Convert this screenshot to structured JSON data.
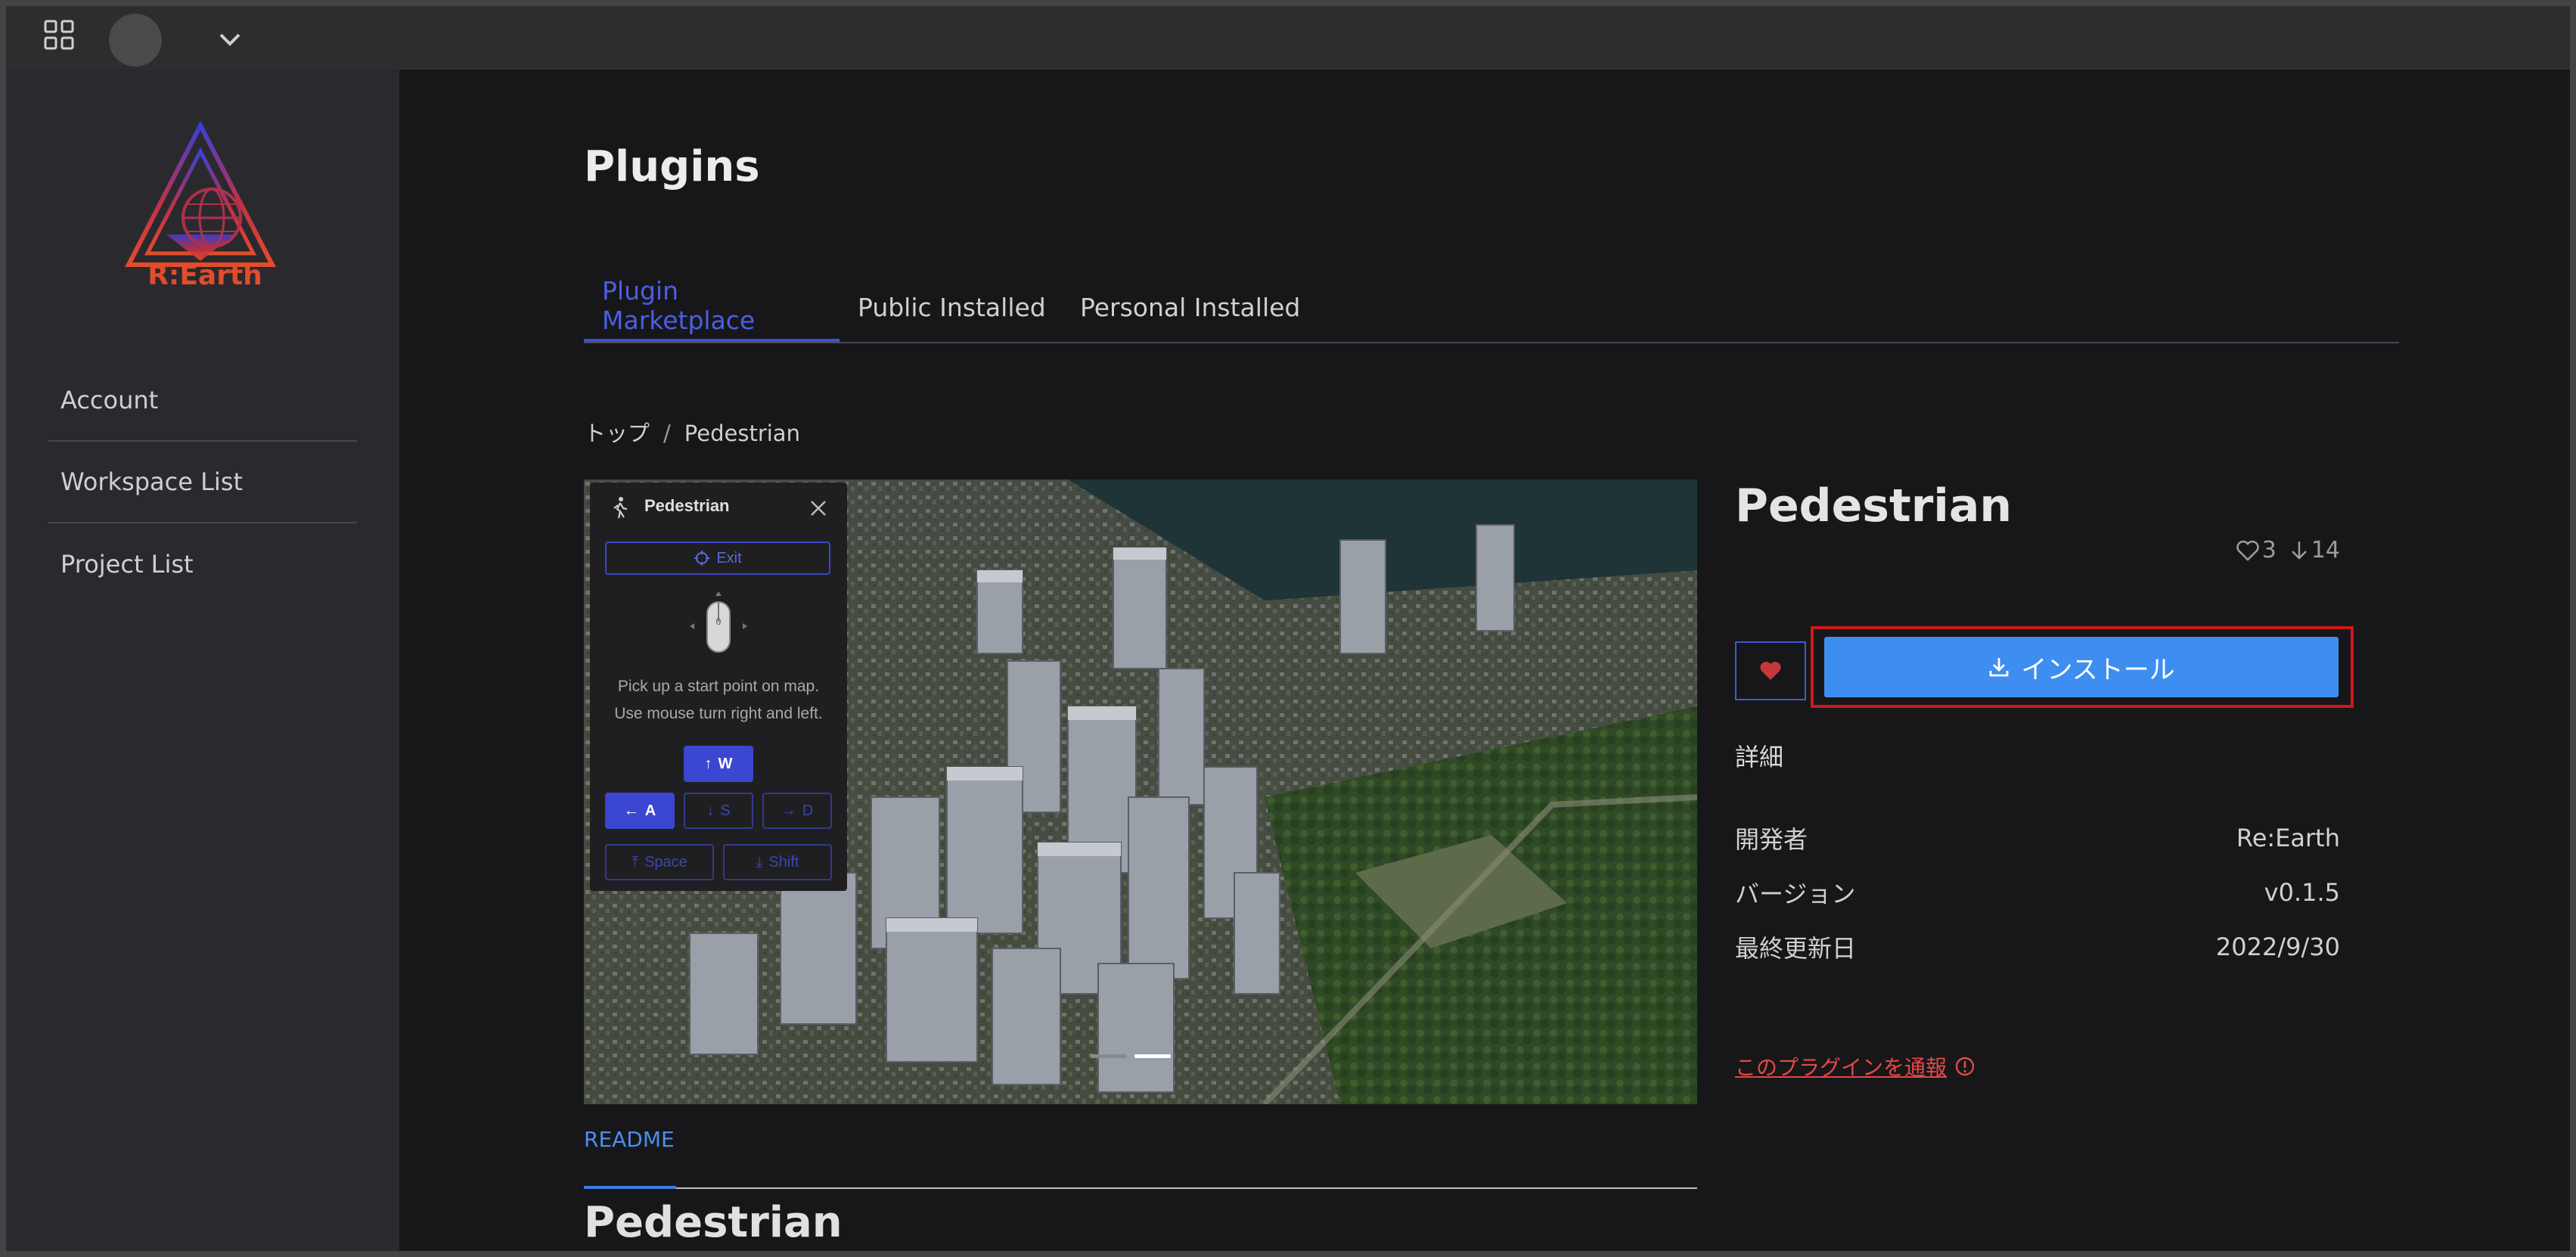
{
  "header": {
    "icons": [
      "grid-icon",
      "avatar",
      "chevron-down-icon"
    ]
  },
  "sidebar": {
    "logo_text": "R:Earth",
    "items": [
      {
        "label": "Account"
      },
      {
        "label": "Workspace List"
      },
      {
        "label": "Project List"
      }
    ]
  },
  "main": {
    "title": "Plugins",
    "tabs": [
      {
        "label": "Plugin Marketplace",
        "active": true
      },
      {
        "label": "Public Installed",
        "active": false
      },
      {
        "label": "Personal Installed",
        "active": false
      }
    ],
    "breadcrumb": {
      "home": "トップ",
      "separator": "/",
      "current": "Pedestrian"
    },
    "hero": {
      "overlay": {
        "title": "Pedestrian",
        "exit_label": "Exit",
        "mouse_zero": "0",
        "hint_line1": "Pick up a start point on map.",
        "hint_line2": "Use mouse turn right and left.",
        "key_w": "W",
        "key_a": "A",
        "key_s": "S",
        "key_d": "D",
        "key_space": "Space",
        "key_shift": "Shift"
      },
      "carousel": {
        "slides": 2,
        "active": 2
      }
    },
    "readme": {
      "tab_label": "README",
      "heading": "Pedestrian"
    }
  },
  "plugin": {
    "name": "Pedestrian",
    "likes": "3",
    "downloads": "14",
    "install_label": "インストール",
    "details_heading": "詳細",
    "details": [
      {
        "key": "開発者",
        "value": "Re:Earth"
      },
      {
        "key": "バージョン",
        "value": "v0.1.5"
      },
      {
        "key": "最終更新日",
        "value": "2022/9/30"
      }
    ],
    "report_label": "このプラグインを通報"
  },
  "colors": {
    "accent": "#3f51d9",
    "install": "#3d8ef0",
    "highlight_box": "#d01818",
    "report": "#e24848",
    "logo": "#e24c2a"
  }
}
